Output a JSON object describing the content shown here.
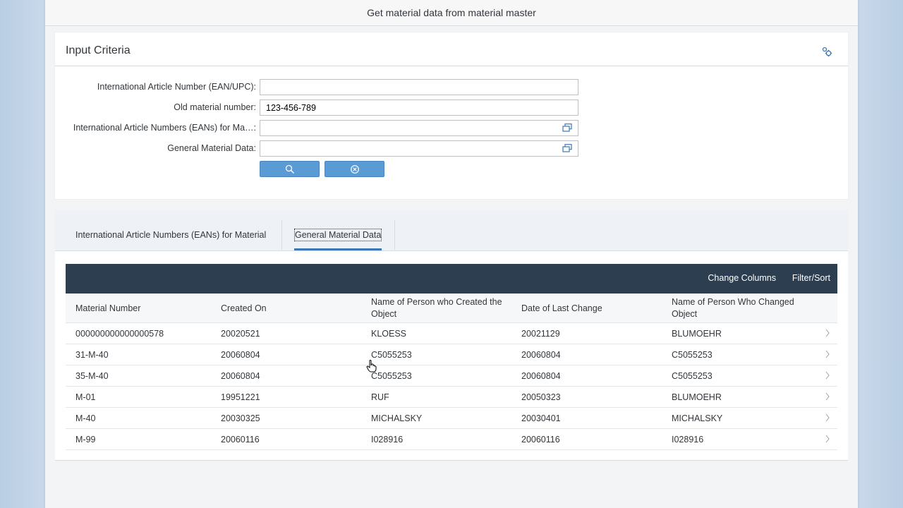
{
  "window": {
    "title": "Get material data from material master"
  },
  "input_criteria": {
    "title": "Input Criteria",
    "settings_icon": "settings-icon",
    "fields": [
      {
        "label": "International Article Number (EAN/UPC):",
        "value": "",
        "has_value_help": false
      },
      {
        "label": "Old material number:",
        "value": "123-456-789",
        "has_value_help": false
      },
      {
        "label": "International Article Numbers (EANs) for Ma…:",
        "value": "",
        "has_value_help": true
      },
      {
        "label": "General Material Data:",
        "value": "",
        "has_value_help": true
      }
    ],
    "search_button_icon": "search-icon",
    "reset_button_icon": "reset-icon"
  },
  "tabs": [
    {
      "label": "International Article Numbers (EANs) for Material",
      "active": false
    },
    {
      "label": "General Material Data",
      "active": true
    }
  ],
  "table": {
    "toolbar": {
      "change_columns": "Change Columns",
      "filter_sort": "Filter/Sort"
    },
    "columns": [
      "Material Number",
      "Created On",
      "Name of Person who Created the Object",
      "Date of Last Change",
      "Name of Person Who Changed Object"
    ],
    "rows": [
      [
        "000000000000000578",
        "20020521",
        "KLOESS",
        "20021129",
        "BLUMOEHR"
      ],
      [
        "31-M-40",
        "20060804",
        "C5055253",
        "20060804",
        "C5055253"
      ],
      [
        "35-M-40",
        "20060804",
        "C5055253",
        "20060804",
        "C5055253"
      ],
      [
        "M-01",
        "19951221",
        "RUF",
        "20050323",
        "BLUMOEHR"
      ],
      [
        "M-40",
        "20030325",
        "MICHALSKY",
        "20030401",
        "MICHALSKY"
      ],
      [
        "M-99",
        "20060116",
        "I028916",
        "20060116",
        "I028916"
      ]
    ]
  },
  "colors": {
    "toolbar_bg": "#2c3e4f",
    "button_blue": "#5a9bd5",
    "tab_underline": "#3c78b5"
  }
}
